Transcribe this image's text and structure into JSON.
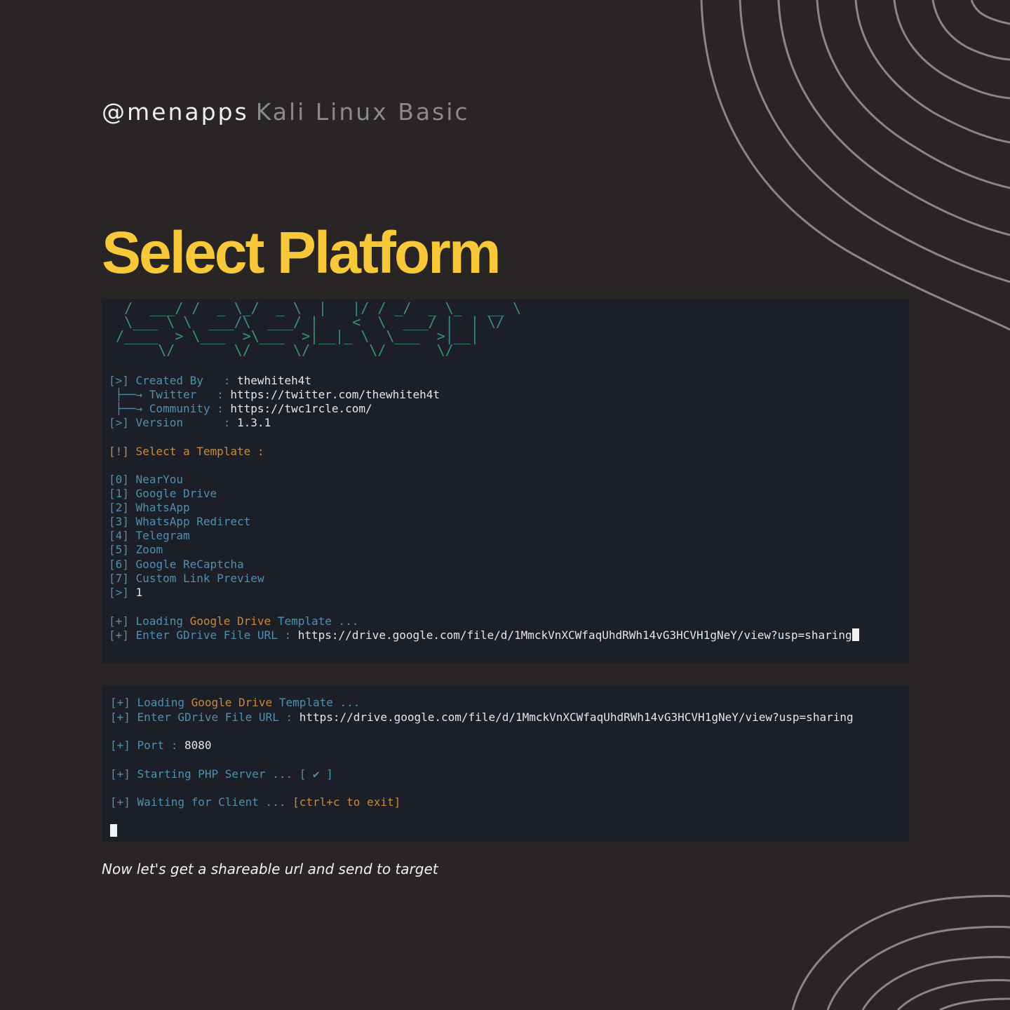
{
  "header": {
    "handle": "@menapps",
    "subtitle": "Kali Linux Basic"
  },
  "title": "Select Platform",
  "terminal1": {
    "ascii_art": "  /  ___/ /  _ \\_/  _ \\  |   |/ / _/  _ \\_   __ \\\n  \\___ \\ \\  ___/\\  ___/ |    <  \\  ___/ |  | \\/\n /____  > \\___  >\\___  >|__|_ \\  \\___  >|__|\n      \\/       \\/     \\/       \\/      \\/",
    "info": [
      {
        "prefix": "[>] ",
        "label": "Created By   ",
        "sep": ": ",
        "value": "thewhiteh4t"
      },
      {
        "prefix": " ├──→ ",
        "label": "Twitter   ",
        "sep": ": ",
        "value": "https://twitter.com/thewhiteh4t"
      },
      {
        "prefix": " ├──→ ",
        "label": "Community ",
        "sep": ": ",
        "value": "https://twc1rcle.com/"
      },
      {
        "prefix": "[>] ",
        "label": "Version      ",
        "sep": ": ",
        "value": "1.3.1"
      }
    ],
    "prompt": "[!] Select a Template :",
    "templates": [
      {
        "idx": "[0]",
        "name": "NearYou"
      },
      {
        "idx": "[1]",
        "name": "Google Drive"
      },
      {
        "idx": "[2]",
        "name": "WhatsApp"
      },
      {
        "idx": "[3]",
        "name": "WhatsApp Redirect"
      },
      {
        "idx": "[4]",
        "name": "Telegram"
      },
      {
        "idx": "[5]",
        "name": "Zoom"
      },
      {
        "idx": "[6]",
        "name": "Google ReCaptcha"
      },
      {
        "idx": "[7]",
        "name": "Custom Link Preview"
      }
    ],
    "choice_prefix": "[>]",
    "choice_value": "1",
    "loading": {
      "prefix": "[+] ",
      "a": "Loading ",
      "b": "Google Drive",
      "c": " Template ..."
    },
    "url_line": {
      "prefix": "[+] ",
      "label": "Enter GDrive File URL : ",
      "value": "https://drive.google.com/file/d/1MmckVnXCWfaqUhdRWh14vG3HCVH1gNeY/view?usp=sharing"
    }
  },
  "terminal2": {
    "loading": {
      "prefix": "[+] ",
      "a": "Loading ",
      "b": "Google Drive",
      "c": " Template ..."
    },
    "url_line": {
      "prefix": "[+] ",
      "label": "Enter GDrive File URL : ",
      "value": "https://drive.google.com/file/d/1MmckVnXCWfaqUhdRWh14vG3HCVH1gNeY/view?usp=sharing"
    },
    "port": {
      "prefix": "[+] ",
      "label": "Port : ",
      "value": "8080"
    },
    "server": {
      "prefix": "[+] ",
      "label": "Starting PHP Server ... ",
      "status": "[ ✔ ]"
    },
    "waiting": {
      "prefix": "[+] ",
      "label": "Waiting for Client ... ",
      "hint": "[ctrl+c to exit]"
    }
  },
  "caption": "Now let's get a shareable url and send to target",
  "colors": {
    "background": "#292524",
    "accent": "#f7c93a",
    "terminal_bg": "#1c1f28",
    "keyword": "#4f8fb0",
    "highlight": "#c78a3c",
    "decor_lines": "#8a8684"
  },
  "icons": [
    "concentric-arcs-decoration"
  ]
}
